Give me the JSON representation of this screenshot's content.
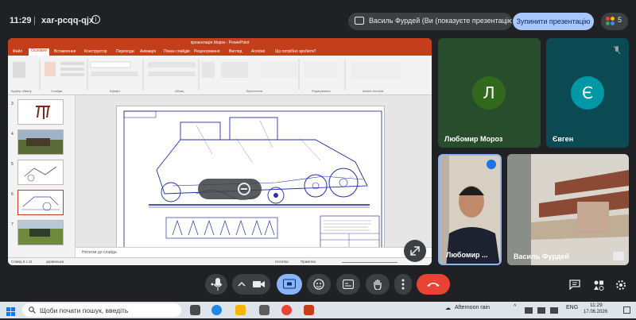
{
  "meet": {
    "time": "11:29",
    "separator": "|",
    "meeting_code": "xar-pcqq-qjx",
    "presenter_chip": "Василь Фурдей (Ви (показуєте презентацію))",
    "stop_button": "Зупинити презентацію",
    "participants_count": "5"
  },
  "powerpoint": {
    "title": "презентація Мороз - PowerPoint",
    "tabs": [
      "Файл",
      "Основне",
      "Вставлення",
      "Конструктор",
      "Переходи",
      "Анімація",
      "Показ слайдів",
      "Рецензування",
      "Вигляд",
      "Acrobat",
      "Що потрібно зробити?"
    ],
    "ribbon_groups": [
      "Буфер обміну",
      "Слайди",
      "Шрифт",
      "Абзац",
      "Креслення",
      "Редагування",
      "Adobe Acrobat"
    ],
    "slide_numbers": [
      "3",
      "4",
      "5",
      "6",
      "7"
    ],
    "notes_placeholder": "Нотатки до слайда",
    "status_slide": "Слайд 6 з 11",
    "status_lang": "українська",
    "status_notes": "Нотатки",
    "status_comments": "Примітки"
  },
  "participants": [
    {
      "name": "Любомир Мороз",
      "initial": "Л",
      "avatar_color": "#33691e",
      "tile_color": "#274d2c"
    },
    {
      "name": "Євген",
      "initial": "Є",
      "avatar_color": "#0097a7",
      "tile_color": "#0b4a52"
    },
    {
      "name": "Любомир ...",
      "initial": "",
      "avatar_color": "",
      "tile_color": ""
    },
    {
      "name": "Василь Фурдей",
      "initial": "",
      "avatar_color": "",
      "tile_color": ""
    }
  ],
  "taskbar": {
    "search_placeholder": "Щоби почати пошук, введіть",
    "weather": "Afternoon rain",
    "lang": "ENG",
    "clock_time": "11:29",
    "clock_date": "17.06.2026"
  },
  "colors": {
    "accent": "#a8c7fa",
    "end_call": "#ea4335",
    "active_present": "#8ab4f8",
    "ppt_brand": "#c43e1c"
  }
}
